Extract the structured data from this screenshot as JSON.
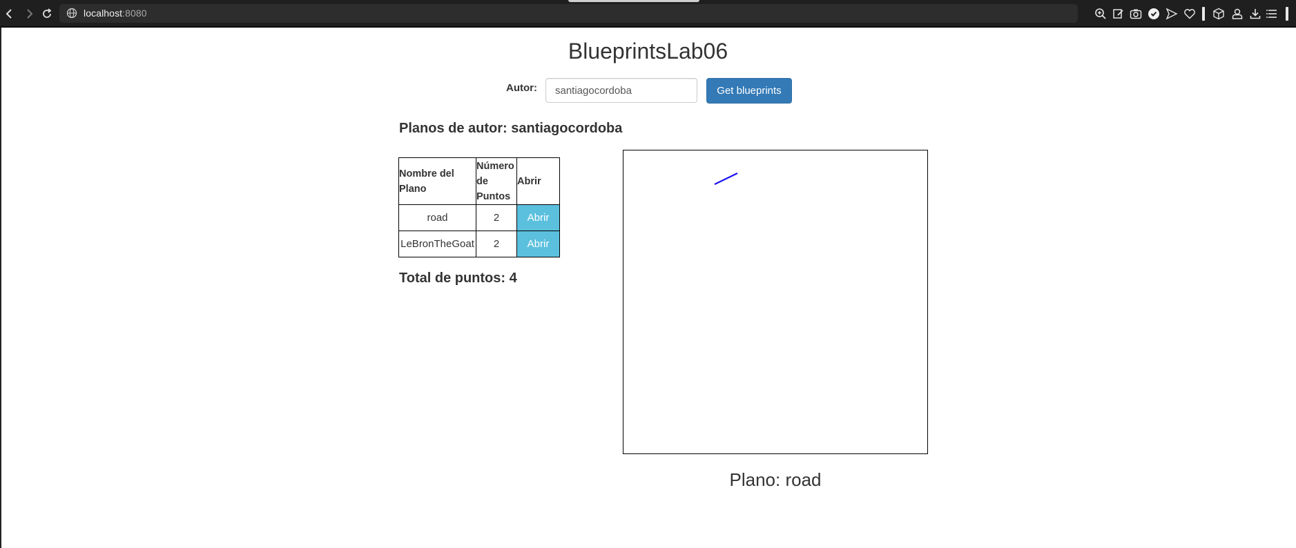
{
  "browser": {
    "url_host": "localhost",
    "url_port": ":8080",
    "nav_icons": [
      "back-icon",
      "forward-icon",
      "reload-icon"
    ],
    "toolbar_icons": [
      "zoom-icon",
      "edit-icon",
      "camera-icon",
      "shield-icon",
      "send-icon",
      "heart-icon",
      "cube-icon",
      "profile-icon",
      "download-icon",
      "menu-icon"
    ]
  },
  "app": {
    "title": "BlueprintsLab06"
  },
  "search": {
    "label": "Autor:",
    "value": "santiagocordoba",
    "button_label": "Get blueprints"
  },
  "results": {
    "heading": "Planos de autor: santiagocordoba",
    "table": {
      "headers": {
        "name": "Nombre del Plano",
        "points": "Número de Puntos",
        "open": "Abrir"
      },
      "rows": [
        {
          "name": "road",
          "points": "2",
          "action": "Abrir"
        },
        {
          "name": "LeBronTheGoat",
          "points": "2",
          "action": "Abrir"
        }
      ]
    },
    "total": "Total de puntos: 4"
  },
  "viewer": {
    "plano_label": "Plano: road",
    "line_color": "#1a12f0"
  },
  "colors": {
    "primary_button": "#337ab7",
    "info_button": "#5bc0de"
  }
}
